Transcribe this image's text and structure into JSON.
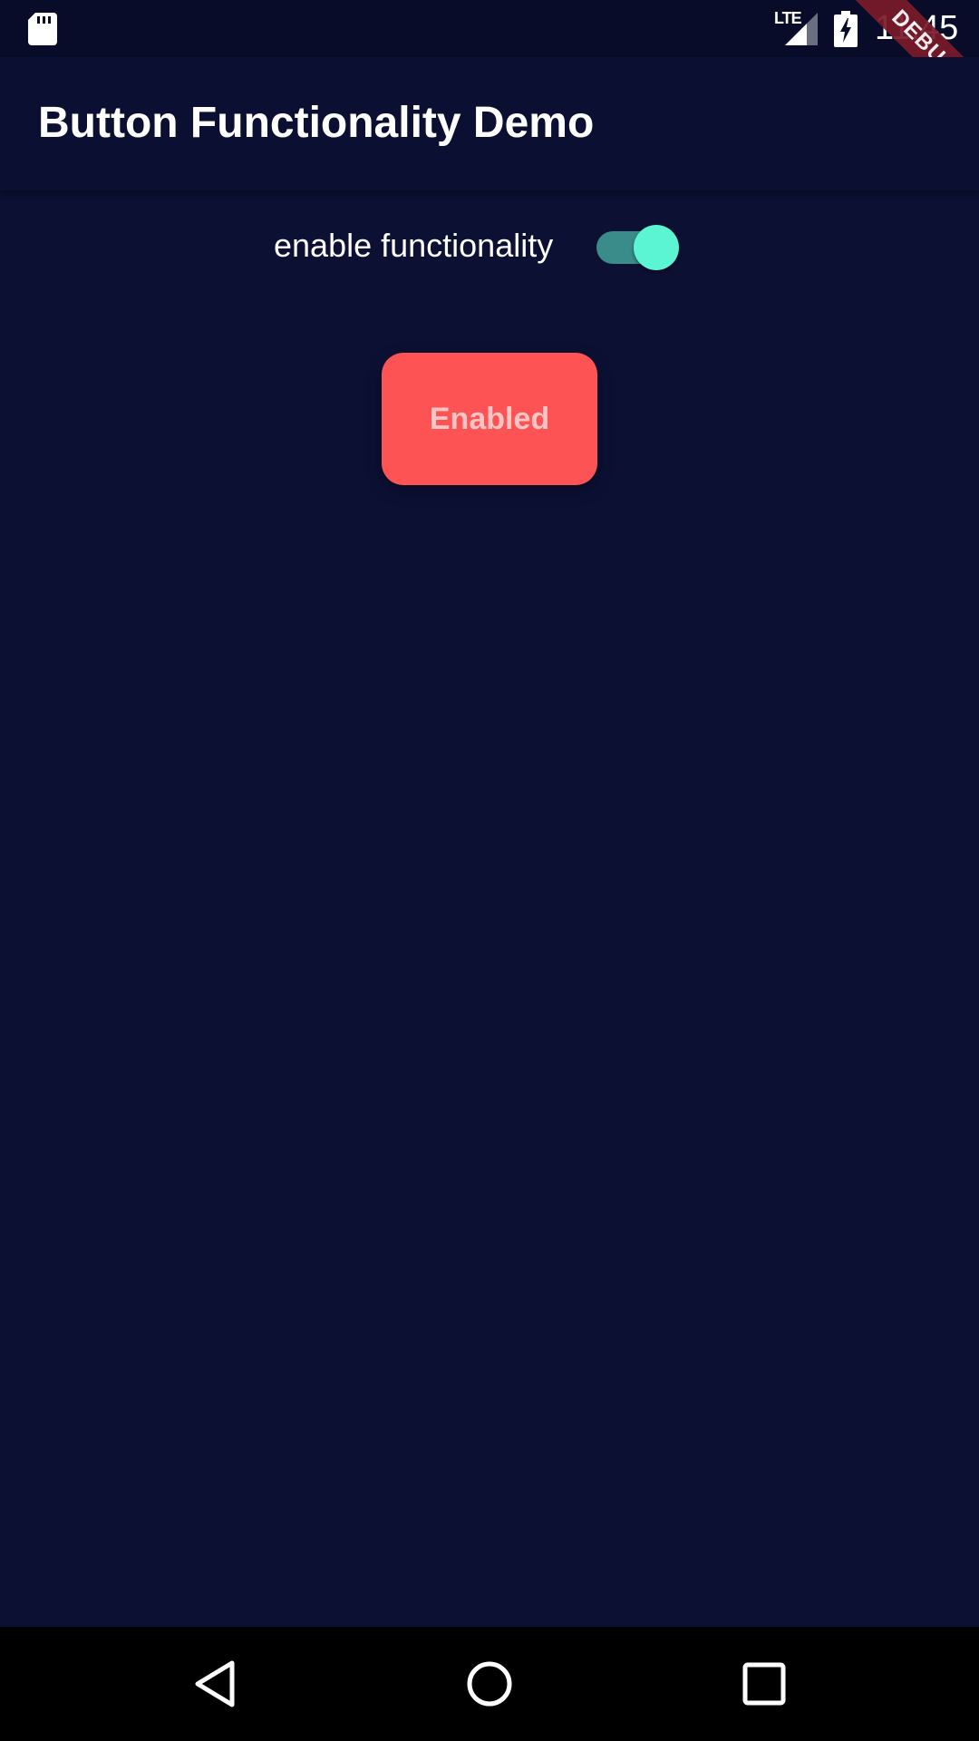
{
  "status_bar": {
    "network_label": "LTE",
    "time": "11:45",
    "icons": [
      "sd-card-icon",
      "lte-signal-icon",
      "battery-charging-icon"
    ]
  },
  "debug_banner": "DEBUG",
  "app_bar": {
    "title": "Button Functionality Demo"
  },
  "switch_row": {
    "label": "enable functionality",
    "checked": true
  },
  "main_button": {
    "label": "Enabled",
    "color": "#fd5354"
  },
  "nav_bar": {
    "icons": [
      "back-icon",
      "home-icon",
      "recents-icon"
    ]
  },
  "colors": {
    "background": "#0c1033",
    "app_bar": "#0b0f31",
    "switch_track": "#3a8c8a",
    "switch_thumb": "#5cf5d3",
    "button": "#fd5354",
    "button_text": "#ffc4c4"
  }
}
